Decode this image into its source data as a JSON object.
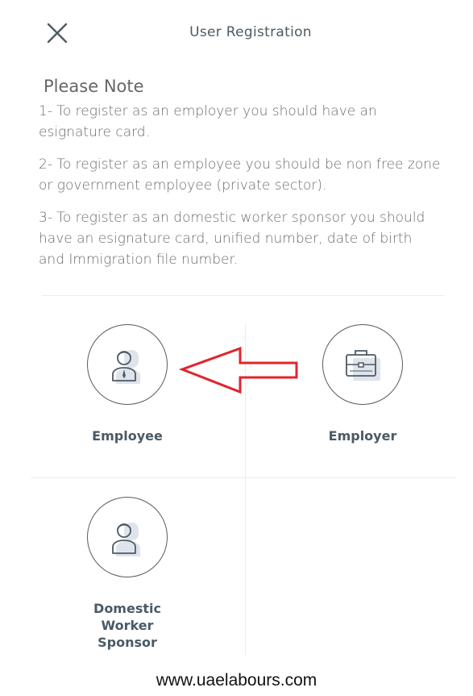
{
  "header": {
    "title": "User Registration",
    "close_icon": "close-icon"
  },
  "note": {
    "heading": "Please Note",
    "items": [
      "1- To register as an employer you should have an esignature card.",
      "2- To register as an employee you should be non free zone or government employee (private sector).",
      "3- To register as an domestic worker sponsor you should have an esignature card, unified number, date of birth and Immigration file number."
    ]
  },
  "options": [
    {
      "label": "Employee",
      "icon": "employee-icon"
    },
    {
      "label": "Employer",
      "icon": "briefcase-icon"
    },
    {
      "label": "Domestic Worker Sponsor",
      "icon": "person-icon"
    }
  ],
  "annotation": {
    "icon": "left-arrow-icon",
    "color": "#e0242c"
  },
  "footer": {
    "watermark": "www.uaelabours.com"
  },
  "colors": {
    "accent_gray": "#4a5a66",
    "icon_fill": "#dfe4ec"
  }
}
